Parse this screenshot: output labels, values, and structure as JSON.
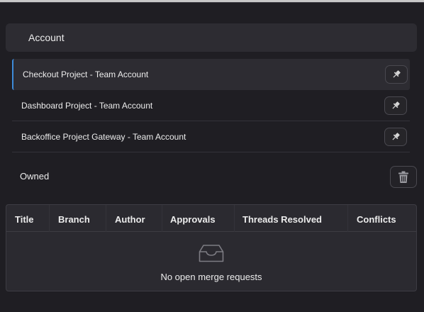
{
  "account": {
    "title": "Account",
    "items": [
      {
        "label": "Checkout Project - Team Account",
        "selected": true
      },
      {
        "label": "Dashboard Project - Team Account",
        "selected": false
      },
      {
        "label": "Backoffice Project Gateway - Team Account",
        "selected": false
      }
    ]
  },
  "owned": {
    "label": "Owned"
  },
  "merge_requests": {
    "columns": [
      "Title",
      "Branch",
      "Author",
      "Approvals",
      "Threads Resolved",
      "Conflicts"
    ],
    "empty_message": "No open merge requests"
  },
  "icons": {
    "pin": "pin-icon",
    "trash": "trash-icon",
    "empty": "inbox-tray-icon"
  },
  "colors": {
    "accent": "#3d8bd9",
    "background": "#1f1e23",
    "panel": "#2d2c32"
  }
}
